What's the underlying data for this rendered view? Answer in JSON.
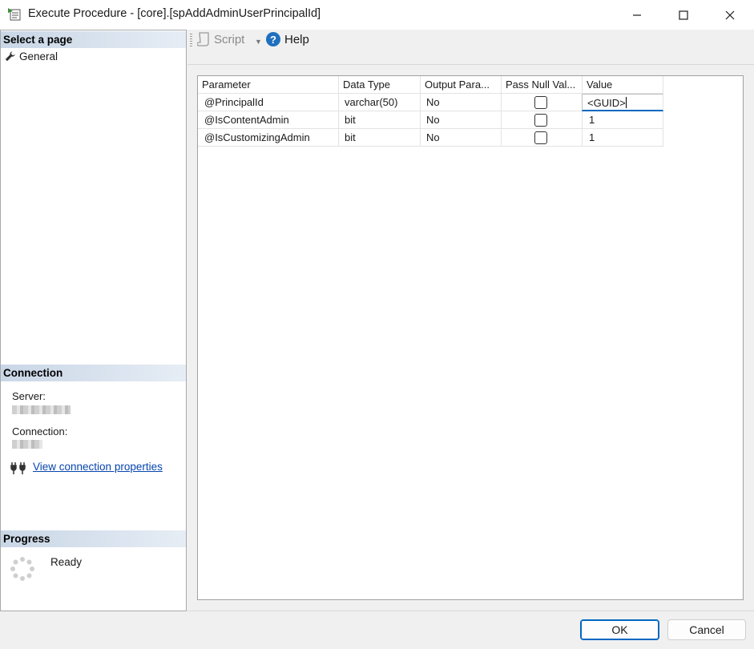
{
  "window": {
    "title": "Execute Procedure - [core].[spAddAdminUserPrincipalId]",
    "minimize_icon": "minimize-icon",
    "maximize_icon": "maximize-icon",
    "close_icon": "close-icon"
  },
  "left_pane": {
    "select_page_header": "Select a page",
    "pages": [
      {
        "label": "General",
        "icon": "wrench-icon"
      }
    ],
    "connection_header": "Connection",
    "server_label": "Server:",
    "connection_label": "Connection:",
    "view_connection_link": "View connection properties",
    "progress_header": "Progress",
    "progress_status": "Ready"
  },
  "toolbar": {
    "script_label": "Script",
    "help_label": "Help",
    "help_icon_glyph": "?"
  },
  "grid": {
    "columns": [
      "Parameter",
      "Data Type",
      "Output Para...",
      "Pass Null Val...",
      "Value"
    ],
    "rows": [
      {
        "parameter": "@PrincipalId",
        "data_type": "varchar(50)",
        "output": "No",
        "pass_null": false,
        "value": "<GUID>"
      },
      {
        "parameter": "@IsContentAdmin",
        "data_type": "bit",
        "output": "No",
        "pass_null": false,
        "value": "1"
      },
      {
        "parameter": "@IsCustomizingAdmin",
        "data_type": "bit",
        "output": "No",
        "pass_null": false,
        "value": "1"
      }
    ]
  },
  "buttons": {
    "ok_label": "OK",
    "cancel_label": "Cancel"
  },
  "colors": {
    "link": "#0645ad",
    "accent": "#0067c0",
    "section_header": "#c9d6e6"
  }
}
